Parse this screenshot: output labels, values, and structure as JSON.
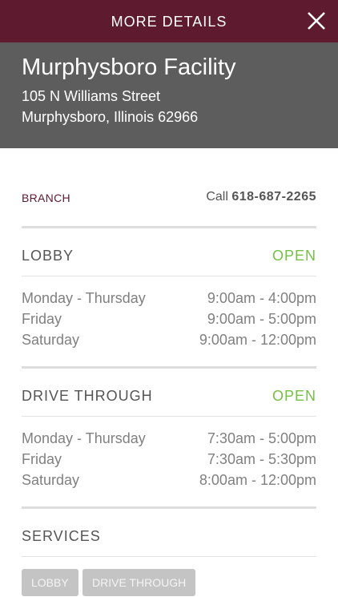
{
  "topbar": {
    "title": "MORE DETAILS",
    "close_icon": "close-icon"
  },
  "facility": {
    "name": "Murphysboro Facility",
    "address_line1": "105 N Williams Street",
    "address_line2": "Murphysboro, Illinois 62966"
  },
  "branch": {
    "label": "BRANCH",
    "call_prefix": "Call",
    "phone": "618-687-2265"
  },
  "lobby": {
    "title": "LOBBY",
    "status": "OPEN",
    "hours": [
      {
        "day": "Monday - Thursday",
        "time": "9:00am - 4:00pm"
      },
      {
        "day": "Friday",
        "time": "9:00am - 5:00pm"
      },
      {
        "day": "Saturday",
        "time": "9:00am - 12:00pm"
      }
    ]
  },
  "drive_through": {
    "title": "DRIVE THROUGH",
    "status": "OPEN",
    "hours": [
      {
        "day": "Monday - Thursday",
        "time": "7:30am - 5:00pm"
      },
      {
        "day": "Friday",
        "time": "7:30am - 5:30pm"
      },
      {
        "day": "Saturday",
        "time": "8:00am - 12:00pm"
      }
    ]
  },
  "services": {
    "title": "SERVICES",
    "chips": [
      "LOBBY",
      "DRIVE THROUGH"
    ]
  },
  "colors": {
    "brand": "#5e1a2e",
    "header_gray": "#5d5d5d",
    "open_green": "#74c043",
    "chip_gray": "#c4c4c4"
  }
}
